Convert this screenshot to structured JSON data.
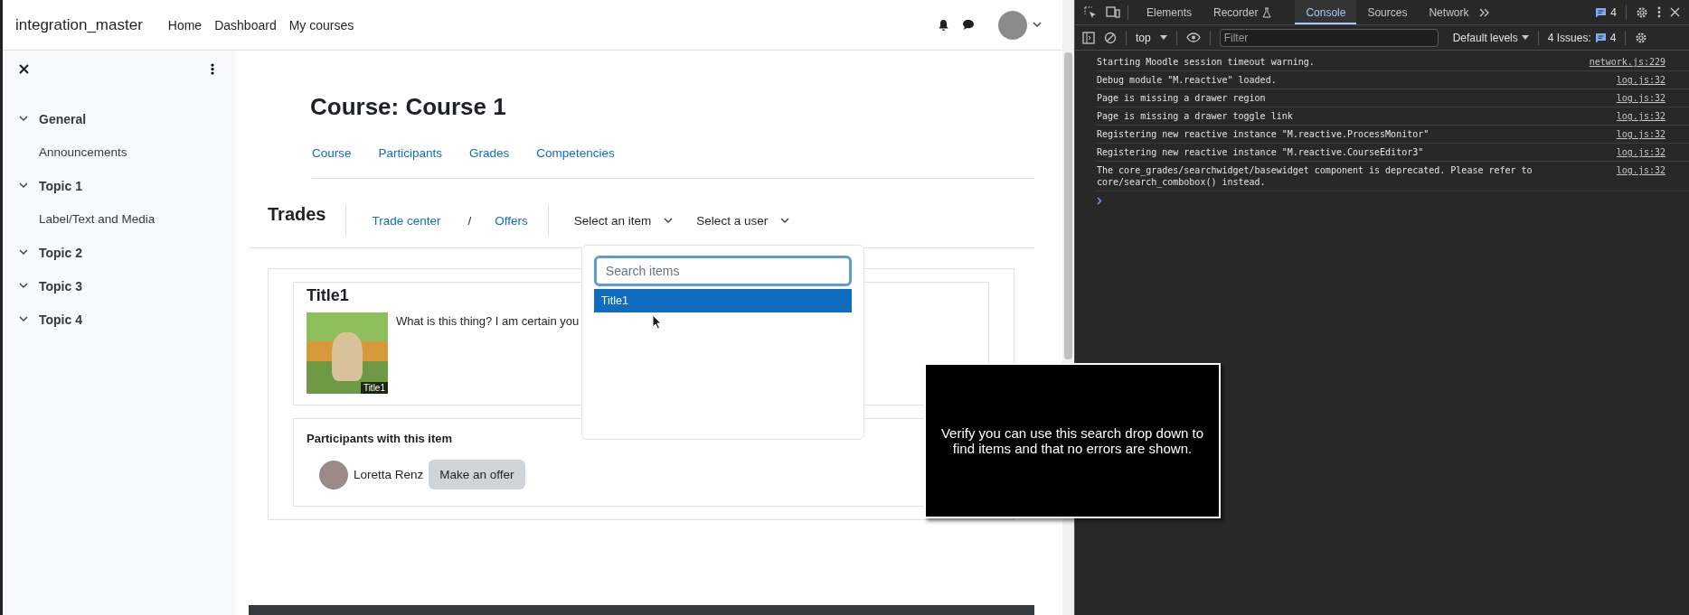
{
  "site_name": "integration_master",
  "nav": [
    {
      "label": "Home"
    },
    {
      "label": "Dashboard"
    },
    {
      "label": "My courses"
    }
  ],
  "drawer": {
    "sections": [
      {
        "title": "General",
        "children": [
          {
            "label": "Announcements"
          }
        ]
      },
      {
        "title": "Topic 1",
        "children": [
          {
            "label": "Label/Text and Media"
          }
        ]
      },
      {
        "title": "Topic 2"
      },
      {
        "title": "Topic 3"
      },
      {
        "title": "Topic 4"
      }
    ]
  },
  "course_title": "Course: Course 1",
  "course_tabs": [
    "Course",
    "Participants",
    "Grades",
    "Competencies"
  ],
  "trades": {
    "heading": "Trades",
    "links": [
      "Trade center",
      "Offers"
    ],
    "separator": "/",
    "selects": [
      "Select an item",
      "Select a user"
    ]
  },
  "item_dropdown": {
    "placeholder": "Search items",
    "options": [
      {
        "label": "Title1",
        "selected": true
      }
    ]
  },
  "item_card": {
    "title": "Title1",
    "image_caption": "Title1",
    "description": "What is this thing? I am certain you"
  },
  "participants": {
    "heading": "Participants with this item",
    "people": [
      {
        "name": "Loretta Renz",
        "action": "Make an offer"
      }
    ]
  },
  "tooltip": "Verify you can use this search drop down to find items and that no errors are shown.",
  "devtools": {
    "tabs": [
      {
        "label": "Elements",
        "selected": false
      },
      {
        "label": "Recorder",
        "selected": false
      },
      {
        "label": "Console",
        "selected": true
      },
      {
        "label": "Sources",
        "selected": false
      },
      {
        "label": "Network",
        "selected": false
      }
    ],
    "messages_count": "4",
    "context": "top",
    "filter_placeholder": "Filter",
    "levels": "Default levels",
    "issues_label": "4 Issues:",
    "issues_count": "4",
    "messages": [
      {
        "text": "Starting Moodle session timeout warning.",
        "source": "network.js:229"
      },
      {
        "text": "Debug module \"M.reactive\" loaded.",
        "source": "log.js:32"
      },
      {
        "text": "Page is missing a drawer region",
        "source": "log.js:32"
      },
      {
        "text": "Page is missing a drawer toggle link",
        "source": "log.js:32"
      },
      {
        "text": "Registering new reactive instance \"M.reactive.ProcessMonitor\"",
        "source": "log.js:32"
      },
      {
        "text": "Registering new reactive instance \"M.reactive.CourseEditor3\"",
        "source": "log.js:32"
      },
      {
        "text": "The core_grades/searchwidget/basewidget component is deprecated. Please refer to core/search_combobox() instead.",
        "source": "log.js:32"
      }
    ]
  }
}
